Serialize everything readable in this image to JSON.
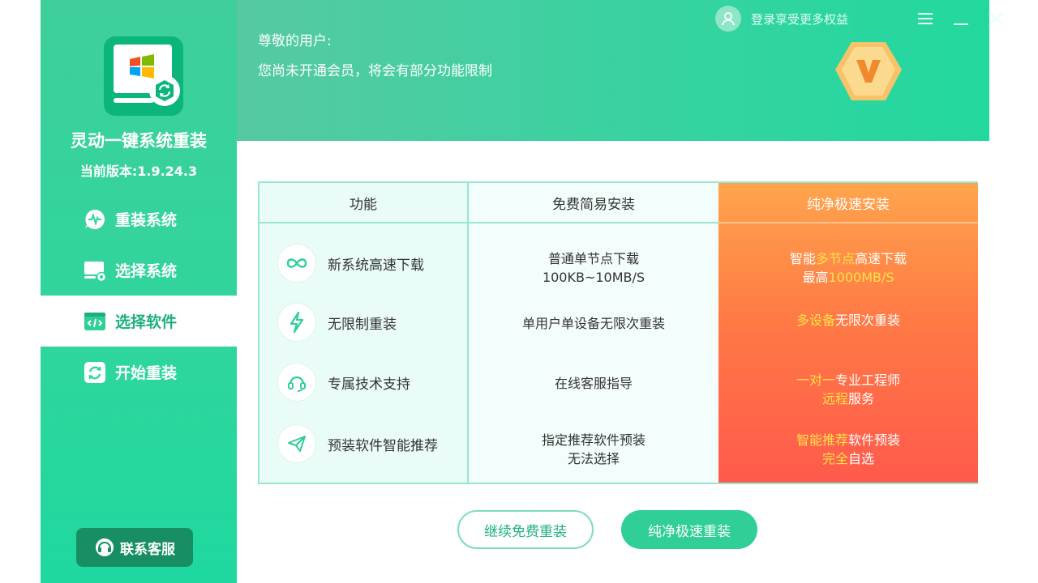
{
  "app": {
    "title": "灵动一键系统重装",
    "version": "当前版本:1.9.24.3"
  },
  "sidebar": {
    "items": [
      {
        "label": "重装系统",
        "icon": "chat-pulse-icon"
      },
      {
        "label": "选择系统",
        "icon": "monitor-gear-icon"
      },
      {
        "label": "选择软件",
        "icon": "code-window-icon",
        "active": true
      },
      {
        "label": "开始重装",
        "icon": "refresh-icon"
      }
    ],
    "support_label": "联系客服"
  },
  "header": {
    "greeting": "尊敬的用户:",
    "notice": "您尚未开通会员，将会有部分功能限制",
    "login_label": "登录享受更多权益"
  },
  "table": {
    "headers": [
      "功能",
      "免费简易安装",
      "纯净极速安装"
    ],
    "features": [
      {
        "label": "新系统高速下载",
        "icon": "infinity-icon"
      },
      {
        "label": "无限制重装",
        "icon": "lightning-icon"
      },
      {
        "label": "专属技术支持",
        "icon": "headset-icon"
      },
      {
        "label": "预装软件智能推荐",
        "icon": "paper-plane-icon"
      }
    ],
    "free": [
      [
        "普通单节点下载",
        "100KB~10MB/S"
      ],
      [
        "单用户单设备无限次重装"
      ],
      [
        "在线客服指导"
      ],
      [
        "指定推荐软件预装",
        "无法选择"
      ]
    ],
    "premium": [
      [
        [
          {
            "t": "智能",
            "h": false
          },
          {
            "t": "多节点",
            "h": true
          },
          {
            "t": "高速下载",
            "h": false
          }
        ],
        [
          {
            "t": "最高",
            "h": false
          },
          {
            "t": "1000MB/S",
            "h": true
          }
        ]
      ],
      [
        [
          {
            "t": "多设备",
            "h": true
          },
          {
            "t": "无限次重装",
            "h": false
          }
        ]
      ],
      [
        [
          {
            "t": "一对一",
            "h": true
          },
          {
            "t": "专业工程师",
            "h": false
          }
        ],
        [
          {
            "t": "远程",
            "h": true
          },
          {
            "t": "服务",
            "h": false
          }
        ]
      ],
      [
        [
          {
            "t": "智能推荐",
            "h": true
          },
          {
            "t": "软件预装",
            "h": false
          }
        ],
        [
          {
            "t": "完全",
            "h": true
          },
          {
            "t": "自选",
            "h": false
          }
        ]
      ]
    ]
  },
  "actions": {
    "free_label": "继续免费重装",
    "fast_label": "纯净极速重装"
  },
  "colors": {
    "accent": "#2fcf95",
    "highlight": "#ffe24a",
    "premium_top": "#ffa54d",
    "premium_bottom": "#ff5a4c"
  }
}
